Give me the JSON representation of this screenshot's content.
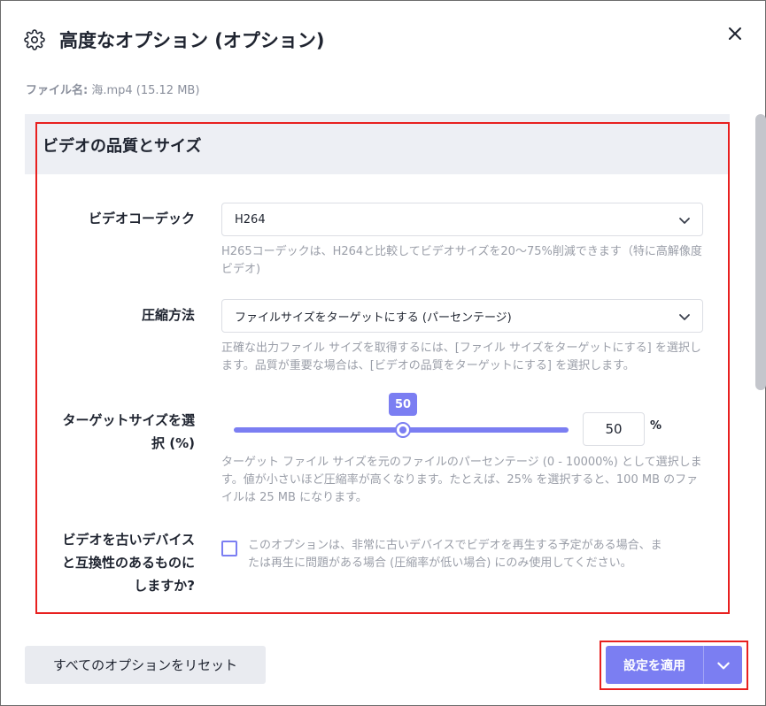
{
  "dialog": {
    "title": "高度なオプション (オプション)",
    "file_label": "ファイル名:",
    "file_value": " 海.mp4 (15.12 MB)"
  },
  "section": {
    "title": "ビデオの品質とサイズ"
  },
  "codec": {
    "label": "ビデオコーデック",
    "value": "H264",
    "hint": "H265コーデックは、H264と比較してビデオサイズを20〜75%削減できます（特に高解像度ビデオ)"
  },
  "compression": {
    "label": "圧縮方法",
    "value": "ファイルサイズをターゲットにする (パーセンテージ)",
    "hint": "正確な出力ファイル サイズを取得するには、[ファイル サイズをターゲットにする] を選択します。品質が重要な場合は、[ビデオの品質をターゲットにする] を選択します。"
  },
  "target_size": {
    "label_line1": "ターゲットサイズを選",
    "label_line2": "択 (%)",
    "slider_value": 50,
    "bubble": "50",
    "input_value": "50",
    "unit": "%",
    "hint": "ターゲット ファイル サイズを元のファイルのパーセンテージ (0 - 10000%) として選択します。値が小さいほど圧縮率が高くなります。たとえば、25% を選択すると、100 MB のファイルは 25 MB になります。"
  },
  "compat": {
    "label_line1": "ビデオを古いデバイス",
    "label_line2": "と互換性のあるものに",
    "label_line3": "しますか?",
    "checked": false,
    "hint": "このオプションは、非常に古いデバイスでビデオを再生する予定がある場合、または再生に問題がある場合 (圧縮率が低い場合) にのみ使用してください。"
  },
  "footer": {
    "reset_label": "すべてのオプションをリセット",
    "apply_label": "設定を適用"
  },
  "colors": {
    "accent": "#7b7ef2",
    "highlight": "#e8201f",
    "section_bg": "#edeff4"
  }
}
